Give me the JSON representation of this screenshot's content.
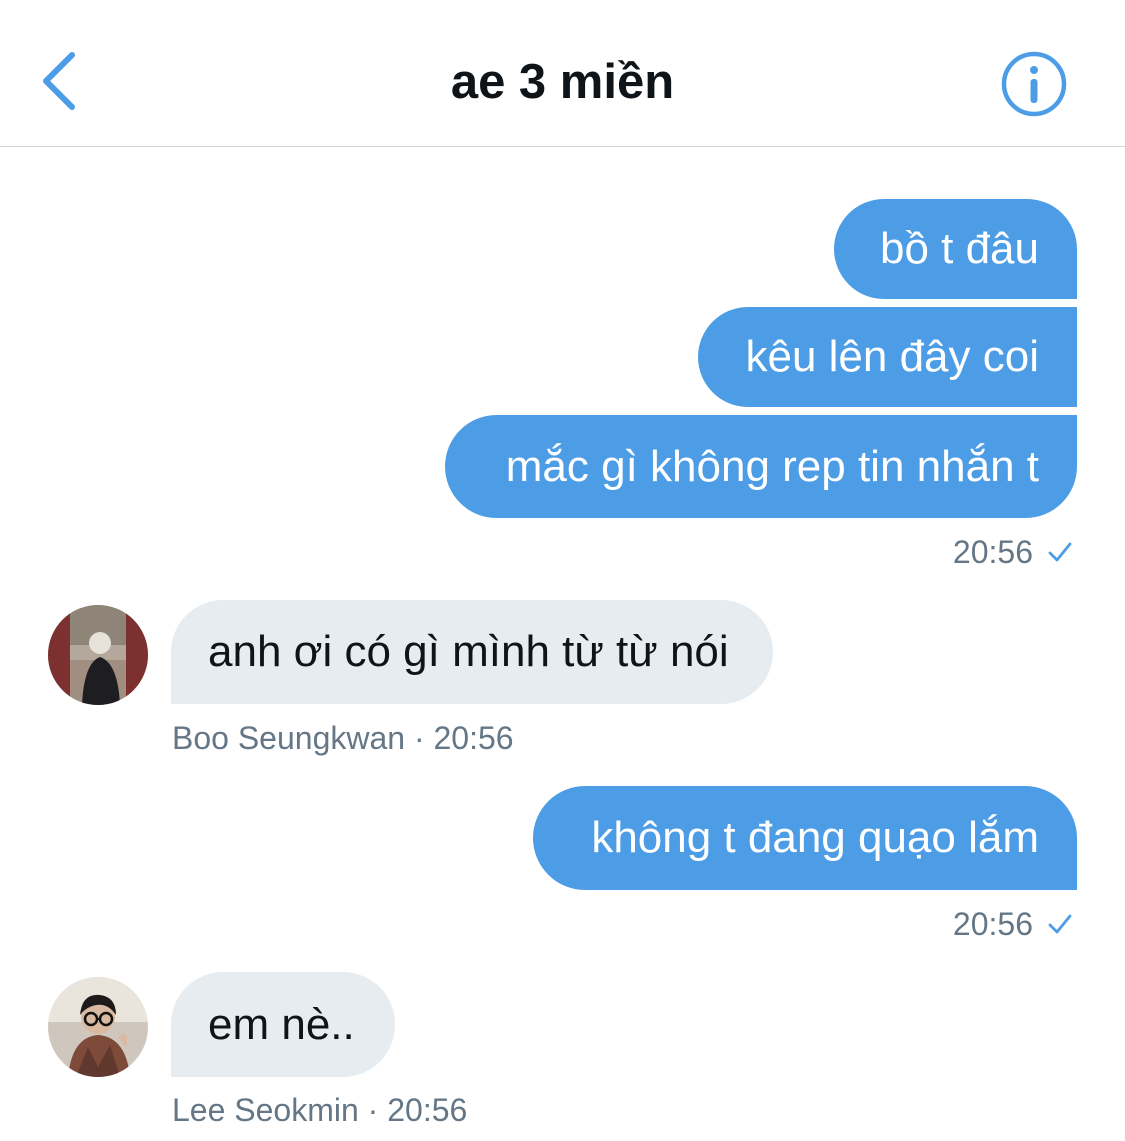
{
  "header": {
    "title": "ae 3 miền",
    "back_icon": "chevron-left-icon",
    "info_icon": "info-circle-icon"
  },
  "colors": {
    "accent": "#4d9de6",
    "incoming_bubble": "#e6ecf0",
    "meta_text": "#657786"
  },
  "messages": [
    {
      "direction": "out",
      "text": "bồ t đâu"
    },
    {
      "direction": "out",
      "text": "kêu lên đây coi"
    },
    {
      "direction": "out",
      "text": "mắc gì không rep tin nhắn t"
    },
    {
      "direction": "out_meta",
      "time": "20:56",
      "status": "sent-check-icon"
    },
    {
      "direction": "in",
      "text": "anh ơi có gì mình từ từ nói",
      "sender": "Boo Seungkwan",
      "time": "20:56",
      "meta": "Boo Seungkwan · 20:56"
    },
    {
      "direction": "out",
      "text": "không t đang quạo lắm"
    },
    {
      "direction": "out_meta",
      "time": "20:56",
      "status": "sent-check-icon"
    },
    {
      "direction": "in",
      "text": "em nè..",
      "sender": "Lee Seokmin",
      "time": "20:56",
      "meta": "Lee Seokmin · 20:56"
    }
  ]
}
